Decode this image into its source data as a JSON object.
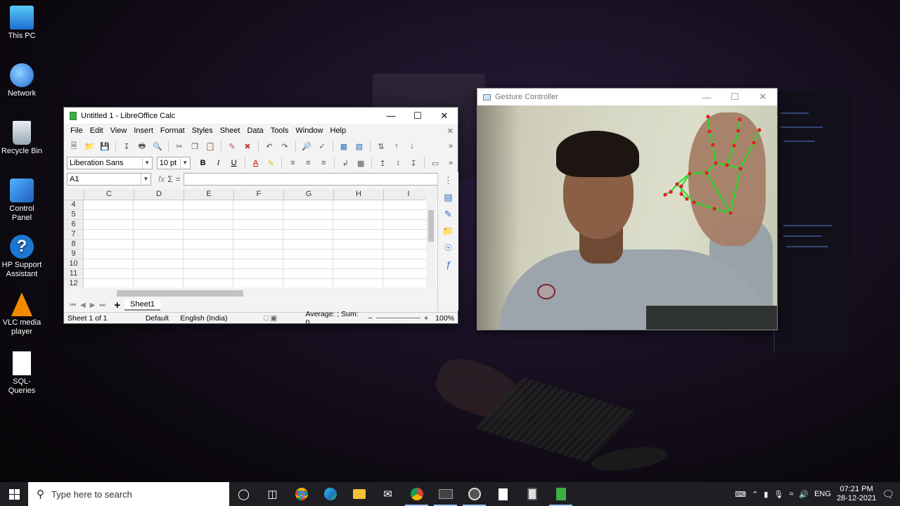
{
  "desktop": {
    "icons": [
      {
        "label": "This PC",
        "icon": "computer-icon"
      },
      {
        "label": "Network",
        "icon": "network-icon"
      },
      {
        "label": "Recycle Bin",
        "icon": "recycle-bin-icon"
      },
      {
        "label": "Control Panel",
        "icon": "control-panel-icon"
      },
      {
        "label": "HP Support Assistant",
        "icon": "help-icon"
      },
      {
        "label": "VLC media player",
        "icon": "vlc-cone-icon"
      },
      {
        "label": "SQL-Queries",
        "icon": "document-icon"
      }
    ]
  },
  "calc": {
    "title": "Untitled 1 - LibreOffice Calc",
    "menu": [
      "File",
      "Edit",
      "View",
      "Insert",
      "Format",
      "Styles",
      "Sheet",
      "Data",
      "Tools",
      "Window",
      "Help"
    ],
    "font_name": "Liberation Sans",
    "font_size": "10 pt",
    "bold": "B",
    "italic": "I",
    "underline": "U",
    "name_box": "A1",
    "fx": "fx",
    "sigma": "Σ",
    "equals": "=",
    "columns": [
      "C",
      "D",
      "E",
      "F",
      "G",
      "H",
      "I"
    ],
    "rows": [
      "4",
      "5",
      "6",
      "7",
      "8",
      "9",
      "10",
      "11",
      "12"
    ],
    "sheet_tab": "Sheet1",
    "add_sheet": "+",
    "status": {
      "sheet": "Sheet 1 of 1",
      "page_style": "Default",
      "language": "English (India)",
      "sum": "Average: ; Sum: 0",
      "zoom_minus": "−",
      "zoom_plus": "+",
      "zoom": "100%"
    }
  },
  "gesture": {
    "title": "Gesture Controller"
  },
  "taskbar": {
    "search_placeholder": "Type here to search",
    "apps": [
      "cortana-icon",
      "task-view-icon",
      "chrome-icon",
      "edge-icon",
      "file-explorer-icon",
      "mail-icon",
      "chrome-profile-icon",
      "terminal-icon",
      "obs-icon",
      "notepad-icon",
      "calculator-icon",
      "libreoffice-calc-icon"
    ],
    "language": "ENG",
    "time": "07:21 PM",
    "date": "28-12-2021"
  },
  "colors": {
    "skeleton_line": "#22dd22",
    "skeleton_point": "#e02020",
    "taskbar": "#1f1e23"
  }
}
